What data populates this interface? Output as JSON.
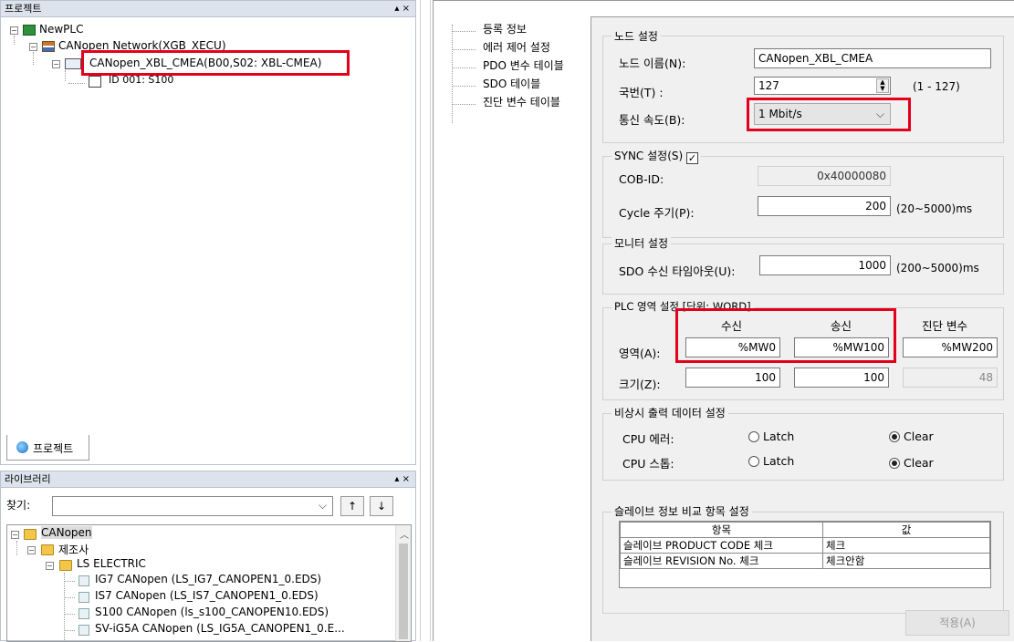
{
  "project_panel": {
    "title": "프로젝트",
    "pin": "▴ ×",
    "tree": {
      "root": "NewPLC",
      "network": "CANopen Network(XGB_XECU)",
      "module": "CANopen_XBL_CMEA(B00,S02: XBL-CMEA)",
      "node": "ID 001: S100"
    },
    "tab_label": "프로젝트"
  },
  "library_panel": {
    "title": "라이브러리",
    "pin": "▴ ×",
    "find_label": "찾기:",
    "find_value": "",
    "up_arrow": "↑",
    "down_arrow": "↓",
    "tree": {
      "root": "CANopen",
      "maker": "제조사",
      "vendor": "LS ELECTRIC",
      "items": [
        "IG7 CANopen (LS_IG7_CANOPEN1_0.EDS)",
        "IS7 CANopen (LS_IS7_CANOPEN1_0.EDS)",
        "S100 CANopen (ls_s100_CANOPEN10.EDS)",
        "SV-iG5A CANopen (LS_IG5A_CANOPEN1_0.E..."
      ]
    }
  },
  "nav_menu": {
    "items": [
      "등록 정보",
      "에러 제어 설정",
      "PDO 변수 테이블",
      "SDO 테이블",
      "진단 변수 테이블"
    ]
  },
  "node_settings": {
    "title": "노드 설정",
    "name_label": "노드 이름(N):",
    "name_value": "CANopen_XBL_CMEA",
    "station_label": "국번(T) :",
    "station_value": "127",
    "station_range": "(1 - 127)",
    "speed_label": "통신 속도(B):",
    "speed_value": "1 Mbit/s"
  },
  "sync_settings": {
    "title": "SYNC 설정(S)",
    "checked": true,
    "cob_label": "COB-ID:",
    "cob_value": "0x40000080",
    "cycle_label": "Cycle 주기(P):",
    "cycle_value": "200",
    "cycle_range": "(20~5000)ms"
  },
  "monitor_settings": {
    "title": "모니터 설정",
    "sdo_label": "SDO 수신 타임아웃(U):",
    "sdo_value": "1000",
    "sdo_range": "(200~5000)ms"
  },
  "plc_area": {
    "title": "PLC 영역 설정 [단위: WORD]",
    "col_recv": "수신",
    "col_send": "송신",
    "col_diag": "진단 변수",
    "area_label": "영역(A):",
    "area_recv": "%MW0",
    "area_send": "%MW100",
    "area_diag": "%MW200",
    "size_label": "크기(Z):",
    "size_recv": "100",
    "size_send": "100",
    "size_diag": "48"
  },
  "emergency": {
    "title": "비상시 출력 데이터 설정",
    "cpu_error_label": "CPU 에러:",
    "cpu_stop_label": "CPU 스톱:",
    "latch": "Latch",
    "clear": "Clear"
  },
  "slave_compare": {
    "title": "슬레이브 정보 비교 항목 설정",
    "col_item": "항목",
    "col_value": "값",
    "rows": [
      {
        "item": "슬레이브 PRODUCT CODE 체크",
        "value": "체크"
      },
      {
        "item": "슬레이브 REVISION No. 체크",
        "value": "체크안함"
      }
    ]
  },
  "apply_button": "적용(A)",
  "colors": {
    "highlight": "#e3001b",
    "panel_bg": "#f0f0f0",
    "header_bg": "#dde3ec"
  }
}
